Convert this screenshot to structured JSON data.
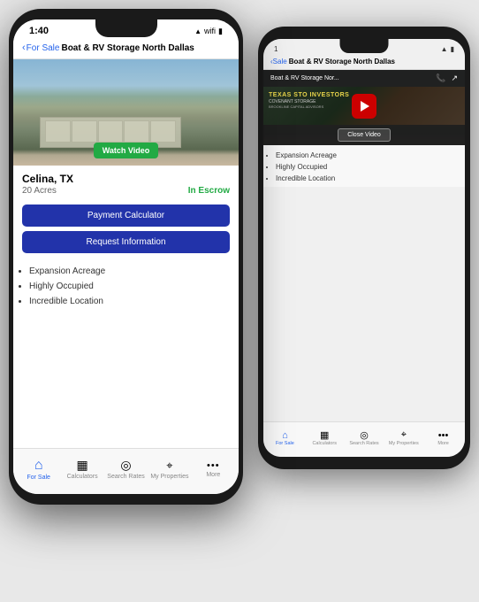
{
  "front_phone": {
    "status": {
      "time": "1:40",
      "signal": "●●●",
      "wifi": "wifi",
      "battery": "battery"
    },
    "nav": {
      "back_label": "For Sale",
      "title": "Boat & RV Storage North Dallas"
    },
    "property": {
      "image_alt": "Aerial view of Boat & RV Storage",
      "watch_video_label": "Watch Video"
    },
    "details": {
      "location": "Celina, TX",
      "acres": "20 Acres",
      "status": "In Escrow"
    },
    "actions": {
      "payment_calc_label": "Payment Calculator",
      "request_info_label": "Request Information"
    },
    "features": [
      "Expansion Acreage",
      "Highly Occupied",
      "Incredible Location"
    ],
    "tabs": [
      {
        "icon": "⌂",
        "label": "For Sale",
        "active": true
      },
      {
        "icon": "▦",
        "label": "Calculators",
        "active": false
      },
      {
        "icon": "◎",
        "label": "Search Rates",
        "active": false
      },
      {
        "icon": "⌖",
        "label": "My Properties",
        "active": false
      },
      {
        "icon": "•••",
        "label": "More",
        "active": false
      }
    ]
  },
  "back_phone": {
    "status": {
      "signal": "●●●",
      "wifi": "▲",
      "battery": "▮"
    },
    "nav": {
      "back_label": "Sale",
      "title": "Boat & RV Storage North Dallas"
    },
    "video": {
      "title": "Boat & RV Storage Nor...",
      "thumbnail_line1": "TEXAS STO  INVESTORS",
      "thumbnail_line2": "COVENANT    STORAGE",
      "thumbnail_line3": "BROOKLINE CAPITAL ADVISORS",
      "play_label": "▶",
      "close_label": "Close Video"
    },
    "features": [
      "Expansion Acreage",
      "Highly Occupied",
      "Incredible Location"
    ],
    "tabs": [
      {
        "icon": "⌂",
        "label": "For Sale",
        "active": true
      },
      {
        "icon": "▦",
        "label": "Calculators",
        "active": false
      },
      {
        "icon": "◎",
        "label": "Search Rates",
        "active": false
      },
      {
        "icon": "⌖",
        "label": "My Properties",
        "active": false
      },
      {
        "icon": "•••",
        "label": "More",
        "active": false
      }
    ]
  }
}
